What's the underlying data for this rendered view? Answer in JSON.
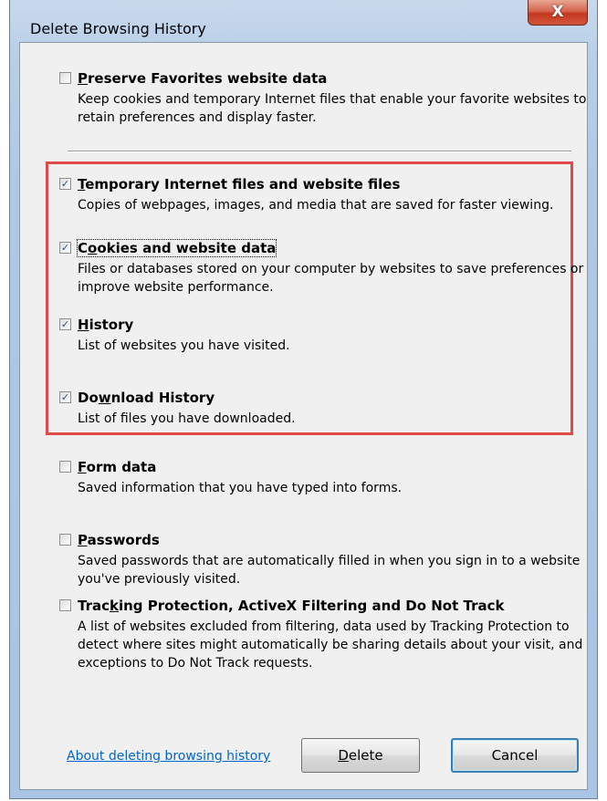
{
  "window": {
    "title": "Delete Browsing History",
    "close_glyph": "X"
  },
  "options": [
    {
      "id": "preserve-favorites",
      "label_pre": "",
      "label_key": "P",
      "label_post": "reserve Favorites website data",
      "description": "Keep cookies and temporary Internet files that enable your favorite websites to retain preferences and display faster.",
      "checked": false
    },
    {
      "id": "temporary-internet-files",
      "label_pre": "",
      "label_key": "T",
      "label_post": "emporary Internet files and website files",
      "description": "Copies of webpages, images, and media that are saved for faster viewing.",
      "checked": true
    },
    {
      "id": "cookies",
      "label_pre": "C",
      "label_key": "o",
      "label_post": "okies and website data",
      "description": "Files or databases stored on your computer by websites to save preferences or improve website performance.",
      "checked": true
    },
    {
      "id": "history",
      "label_pre": "",
      "label_key": "H",
      "label_post": "istory",
      "description": "List of websites you have visited.",
      "checked": true
    },
    {
      "id": "download-history",
      "label_pre": "Do",
      "label_key": "w",
      "label_post": "nload History",
      "description": "List of files you have downloaded.",
      "checked": true
    },
    {
      "id": "form-data",
      "label_pre": "",
      "label_key": "F",
      "label_post": "orm data",
      "description": "Saved information that you have typed into forms.",
      "checked": false
    },
    {
      "id": "passwords",
      "label_pre": "",
      "label_key": "P",
      "label_post": "asswords",
      "description": "Saved passwords that are automatically filled in when you sign in to a website you've previously visited.",
      "checked": false
    },
    {
      "id": "tracking-protection",
      "label_pre": "Trac",
      "label_key": "k",
      "label_post": "ing Protection, ActiveX Filtering and Do Not Track",
      "description": "A list of websites excluded from filtering, data used by Tracking Protection to detect where sites might automatically be sharing details about your visit, and exceptions to Do Not Track requests.",
      "checked": false
    }
  ],
  "footer": {
    "help_link": "About deleting browsing history",
    "delete_label_key": "D",
    "delete_label_rest": "elete",
    "cancel_label": "Cancel"
  },
  "check_glyph": "✓",
  "colors": {
    "highlight": "#e04a48",
    "link": "#0066cc",
    "close_button": "#c4381f"
  }
}
